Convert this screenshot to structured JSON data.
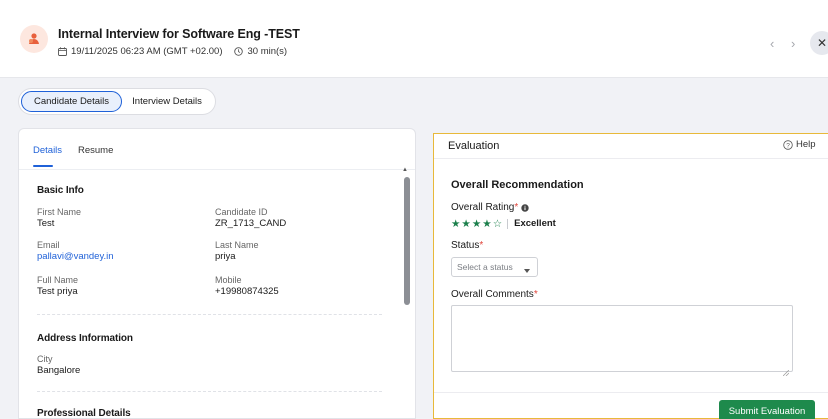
{
  "header": {
    "title": "Internal Interview for Software Eng -TEST",
    "datetime": "19/11/2025 06:23 AM (GMT +02.00)",
    "duration": "30 min(s)",
    "logo_icon": "interview-logo-icon",
    "prev_label": "‹",
    "next_label": "›",
    "close_label": "✕"
  },
  "tabs": [
    {
      "label": "Candidate Details",
      "active": true
    },
    {
      "label": "Interview Details",
      "active": false
    }
  ],
  "left_panel": {
    "tabs": [
      {
        "label": "Details",
        "active": true
      },
      {
        "label": "Resume",
        "active": false
      }
    ],
    "basic_info": {
      "title": "Basic Info",
      "fields": [
        {
          "label": "First Name",
          "value": "Test"
        },
        {
          "label": "Candidate ID",
          "value": "ZR_1713_CAND"
        },
        {
          "label": "Email",
          "value": "pallavi@vandey.in"
        },
        {
          "label": "Last Name",
          "value": "priya"
        },
        {
          "label": "Full Name",
          "value": "Test priya"
        },
        {
          "label": "Mobile",
          "value": "+19980874325"
        }
      ]
    },
    "address": {
      "title": "Address Information",
      "fields": [
        {
          "label": "City",
          "value": "Bangalore"
        }
      ]
    },
    "professional": {
      "title": "Professional Details"
    }
  },
  "evaluation": {
    "title": "Evaluation",
    "help_label": "Help",
    "recommendation_title": "Overall Recommendation",
    "rating_label": "Overall Rating",
    "rating_value": 4,
    "rating_max": 5,
    "rating_text": "Excellent",
    "required_mark": "*",
    "status_label": "Status",
    "status_placeholder": "Select a status",
    "comments_label": "Overall Comments",
    "comments_value": "",
    "submit_label": "Submit Evaluation",
    "accent_color": "#1e8a4c",
    "highlight_color": "#e8b93a",
    "link_color": "#1f61d8"
  }
}
